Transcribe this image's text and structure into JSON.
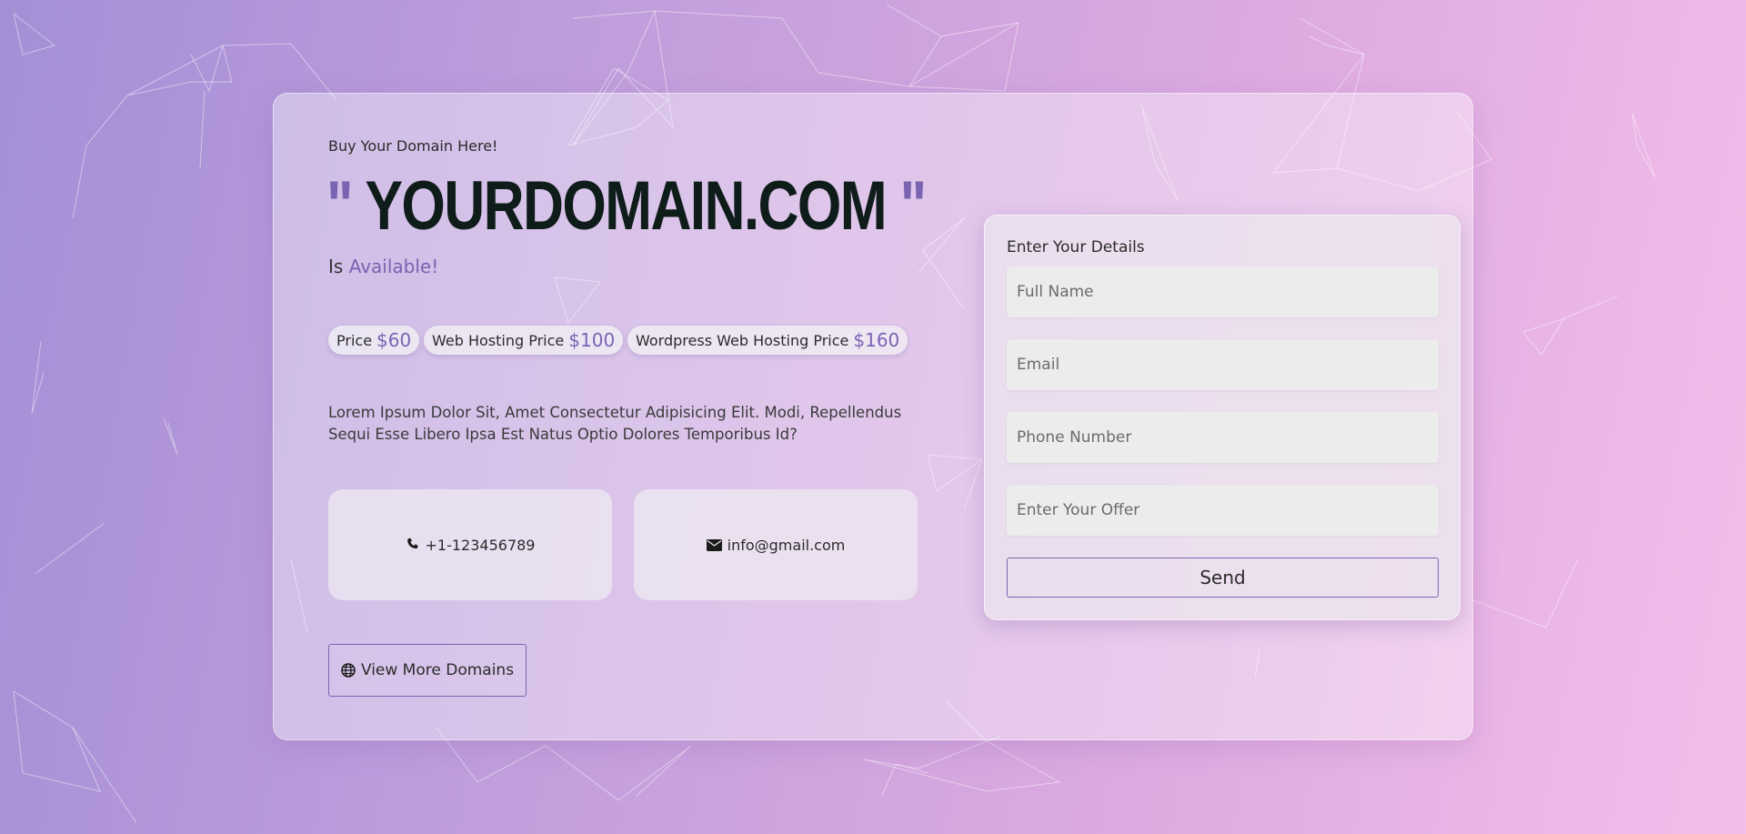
{
  "colors": {
    "accent": "#7a64b2",
    "domain_text": "#0f1d1a",
    "background_start": "#a48fd6",
    "background_end": "#f5bde9"
  },
  "hero": {
    "kicker": "Buy Your Domain Here!",
    "open_quote": "\"",
    "domain": "YOURDOMAIN.COM",
    "close_quote": "\"",
    "status_prefix": "Is",
    "status_word": "Available!"
  },
  "prices": [
    {
      "label": "Price",
      "amount": "$60"
    },
    {
      "label": "Web Hosting Price",
      "amount": "$100"
    },
    {
      "label": "Wordpress Web Hosting Price",
      "amount": "$160"
    }
  ],
  "description": "Lorem Ipsum Dolor Sit, Amet Consectetur Adipisicing Elit. Modi, Repellendus Sequi Esse Libero Ipsa Est Natus Optio Dolores Temporibus Id?",
  "contacts": {
    "phone": {
      "icon": "phone-icon",
      "text": "+1-123456789"
    },
    "email": {
      "icon": "envelope-icon",
      "text": "info@gmail.com"
    }
  },
  "more_button": {
    "icon": "globe-icon",
    "label": "View More Domains"
  },
  "form": {
    "title": "Enter Your Details",
    "full_name_placeholder": "Full Name",
    "email_placeholder": "Email",
    "phone_placeholder": "Phone Number",
    "offer_placeholder": "Enter Your Offer",
    "send_label": "Send"
  }
}
